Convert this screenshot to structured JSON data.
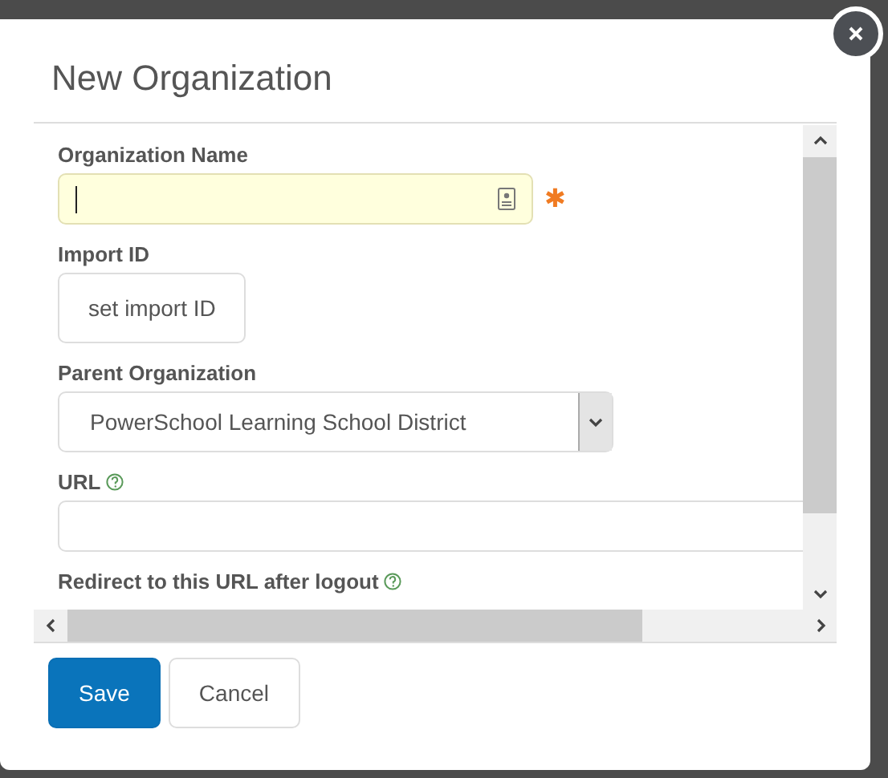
{
  "dialog": {
    "title": "New Organization"
  },
  "fields": [
    {
      "kind": "text",
      "label": "Organization Name",
      "focused": true,
      "required": true,
      "required_mark": "✱"
    },
    {
      "kind": "button",
      "label": "Import ID",
      "button": "set import ID"
    },
    {
      "kind": "select",
      "label": "Parent Organization",
      "value": "PowerSchool Learning School District"
    },
    {
      "kind": "text",
      "label": "URL",
      "focused": false,
      "help": true
    },
    {
      "kind": "label",
      "label": "Redirect to this URL after logout",
      "help": true
    }
  ],
  "buttons": [
    {
      "label": "Save",
      "primary": true
    },
    {
      "label": "Cancel",
      "primary": false
    }
  ]
}
